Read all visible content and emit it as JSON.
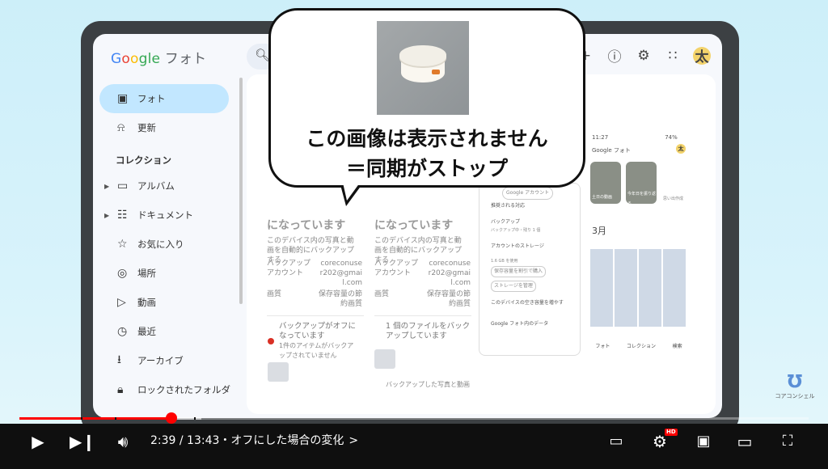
{
  "app": {
    "logo": {
      "g1": "G",
      "g2": "o",
      "g3": "o",
      "g4": "gle",
      "suffix": " フォト"
    },
    "toolbar_avatar": "太"
  },
  "sidebar": {
    "items": [
      {
        "label": "フォト",
        "icon": "photo-icon"
      },
      {
        "label": "更新",
        "icon": "bell-icon"
      }
    ],
    "section_label": "コレクション",
    "collection_items": [
      {
        "label": "アルバム",
        "icon": "album-icon"
      },
      {
        "label": "ドキュメント",
        "icon": "document-icon"
      },
      {
        "label": "お気に入り",
        "icon": "star-icon"
      },
      {
        "label": "場所",
        "icon": "location-icon"
      },
      {
        "label": "動画",
        "icon": "video-icon"
      },
      {
        "label": "最近",
        "icon": "clock-icon"
      },
      {
        "label": "アーカイブ",
        "icon": "archive-icon"
      },
      {
        "label": "ロックされたフォルダ",
        "icon": "lock-icon"
      }
    ]
  },
  "content": {
    "col1": {
      "heading_partial": "になっています",
      "desc": "このデバイス内の写真と動画を自動的にバックアップする",
      "account_label": "バックアップアカウント",
      "account_value": "coreconuser202@gmail.com",
      "quality_label": "画質",
      "quality_value": "保存容量の節約画質",
      "warn_title": "バックアップがオフになっています",
      "warn_sub": "1件のアイテムがバックアップされていません"
    },
    "col2": {
      "heading_partial": "になっています",
      "desc": "このデバイス内の写真と動画を自動的にバックアップする",
      "account_label": "バックアップアカウント",
      "account_value": "coreconuser202@gmail.com",
      "quality_label": "画質",
      "quality_value": "保存容量の節約画質",
      "status": "1 個のファイルをバックアップしています",
      "notice": "バックアップした写真と動画"
    }
  },
  "phone_menu": {
    "account_btn": "Google アカウント",
    "items": [
      "推奨される対応",
      "バックアップ",
      "バックアップ中・残り 1 個",
      "アカウントのストレージ",
      "1.6 GB を使用",
      "保存容量を割引で購入",
      "ストレージを管理",
      "このデバイスの空き容量を増やす",
      "Google フォト内のデータ"
    ]
  },
  "phone_right": {
    "status": "11:27",
    "battery": "74%",
    "title": "Google フォト",
    "avatar": "太",
    "tiles": [
      "土日の動画",
      "今年日を振り返る",
      "思い出作成"
    ],
    "month": "3月",
    "nav": [
      "フォト",
      "コレクション",
      "検索"
    ]
  },
  "bubble": {
    "line1": "この画像は表示されません",
    "line2": "＝同期がストップ"
  },
  "watermark": {
    "text": "コアコンシェル"
  },
  "player": {
    "time": "2:39 / 13:43",
    "chapter": "・オフにした場合の変化",
    "chapter_chevron": ">",
    "progress_fraction": 0.193,
    "hd_badge": "HD"
  }
}
